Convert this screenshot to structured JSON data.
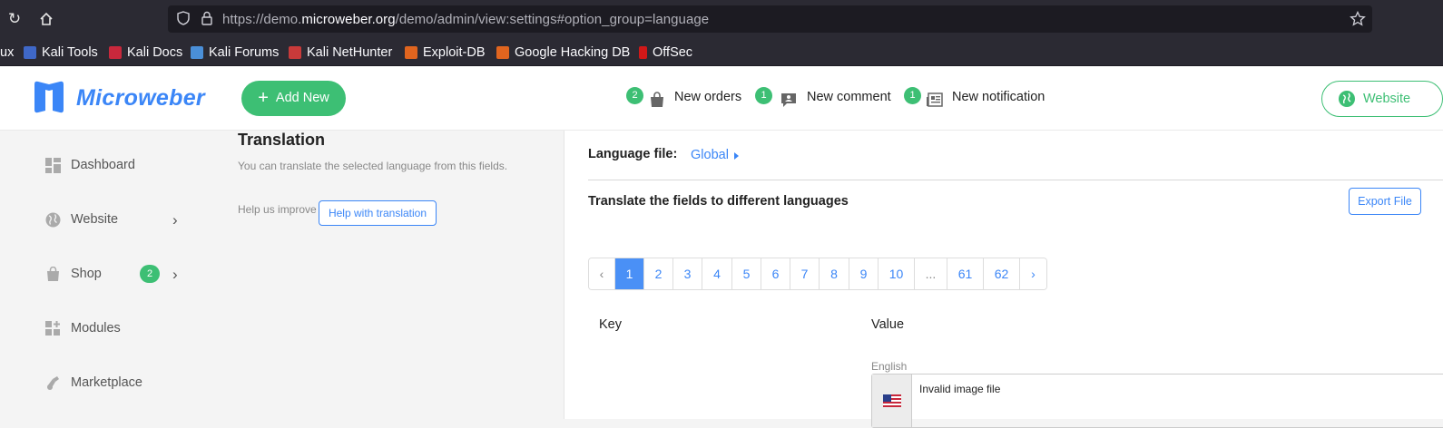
{
  "browser": {
    "url_prefix": "https://demo.",
    "url_domain": "microweber.org",
    "url_suffix": "/demo/admin/view:settings#option_group=language",
    "bookmarks": [
      {
        "label": "ux"
      },
      {
        "label": "Kali Tools"
      },
      {
        "label": "Kali Docs"
      },
      {
        "label": "Kali Forums"
      },
      {
        "label": "Kali NetHunter"
      },
      {
        "label": "Exploit-DB"
      },
      {
        "label": "Google Hacking DB"
      },
      {
        "label": "OffSec"
      }
    ]
  },
  "header": {
    "logo_text": "Microweber",
    "add_new": "Add New",
    "notifications": [
      {
        "count": "2",
        "label": "New orders"
      },
      {
        "count": "1",
        "label": "New comment"
      },
      {
        "count": "1",
        "label": "New notification"
      }
    ],
    "website_button": "Website"
  },
  "sidebar": {
    "items": [
      {
        "label": "Dashboard"
      },
      {
        "label": "Website"
      },
      {
        "label": "Shop",
        "badge": "2"
      },
      {
        "label": "Modules"
      },
      {
        "label": "Marketplace"
      }
    ]
  },
  "translation": {
    "title": "Translation",
    "description": "You can translate the selected language from this fields.",
    "help_label": "Help us improve",
    "help_button": "Help with translation"
  },
  "main": {
    "language_file_label": "Language file:",
    "language_file_value": "Global",
    "section_title": "Translate the fields to different languages",
    "export_button": "Export File",
    "pagination": [
      "‹",
      "1",
      "2",
      "3",
      "4",
      "5",
      "6",
      "7",
      "8",
      "9",
      "10",
      "...",
      "61",
      "62",
      "›"
    ],
    "active_page": "1",
    "col_key": "Key",
    "col_value": "Value",
    "language_name": "English",
    "field_value": "Invalid image file"
  },
  "colors": {
    "accent_green": "#3dbf74",
    "accent_blue": "#3b86f7"
  }
}
